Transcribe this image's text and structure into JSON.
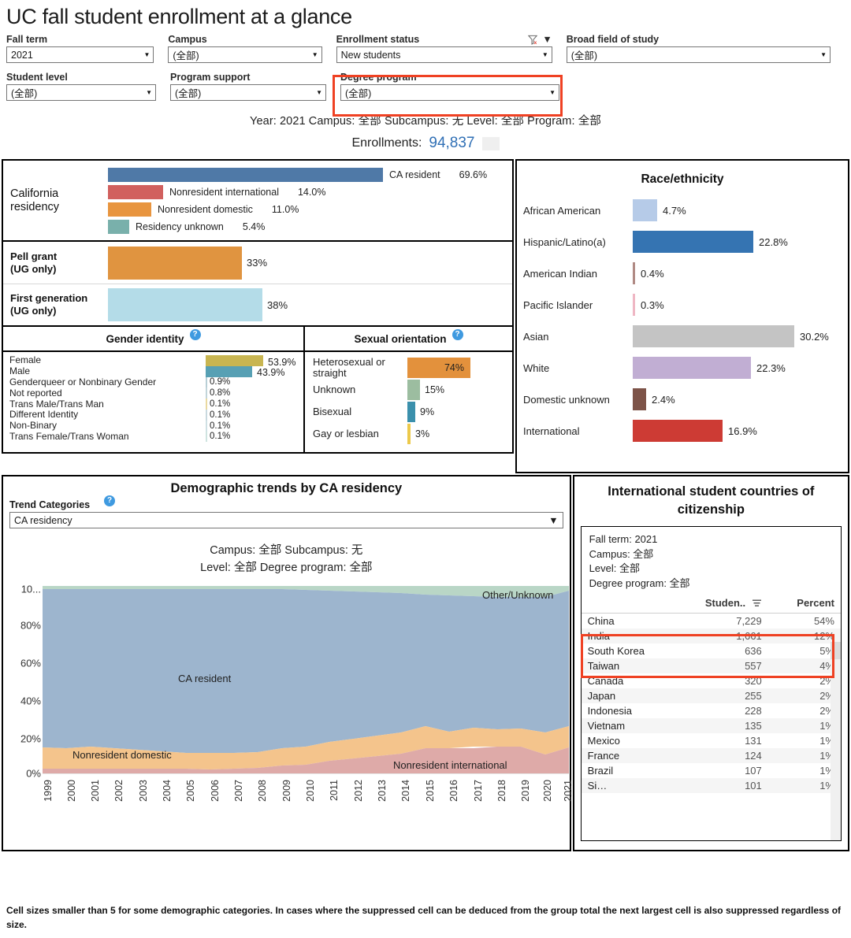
{
  "page": {
    "title": "UC fall student enrollment at a glance",
    "footnote": "Cell sizes smaller than 5 for some demographic categories. In cases where the suppressed cell can be deduced from the group total the next largest cell is also suppressed regardless of size.",
    "accent_highlight": "#ef4123"
  },
  "filters": {
    "row1": [
      {
        "label": "Fall term",
        "value": "2021"
      },
      {
        "label": "Campus",
        "value": "(全部)"
      },
      {
        "label": "Enrollment status",
        "value": "New students",
        "highlighted": true,
        "icons": [
          "clear-filter-icon",
          "chevron-down-icon"
        ]
      },
      {
        "label": "Broad field of study",
        "value": "(全部)"
      }
    ],
    "row2": [
      {
        "label": "Student level",
        "value": "(全部)"
      },
      {
        "label": "Program support",
        "value": "(全部)"
      },
      {
        "label": "Degree program",
        "value": "(全部)"
      }
    ]
  },
  "summary": {
    "context_line": "Year: 2021  Campus: 全部  Subcampus: 无  Level: 全部  Program: 全部",
    "enrollments_label": "Enrollments:",
    "enrollments_value": "94,837"
  },
  "chart_data": [
    {
      "type": "bar",
      "title": "California residency",
      "orientation": "horizontal",
      "categories": [
        "CA resident",
        "Nonresident international",
        "Nonresident domestic",
        "Residency unknown"
      ],
      "values": [
        69.6,
        14.0,
        11.0,
        5.4
      ],
      "value_labels": [
        "69.6%",
        "14.0%",
        "11.0%",
        "5.4%"
      ],
      "colors": [
        "#4f79a7",
        "#d1605e",
        "#e8953f",
        "#79b0ab"
      ],
      "xlabel": "",
      "ylabel": "",
      "xlim": [
        0,
        69.6
      ]
    },
    {
      "type": "bar",
      "title": "Pell grant (UG only) / First generation (UG only)",
      "orientation": "horizontal",
      "categories": [
        "Pell grant\n(UG only)",
        "First generation\n(UG only)"
      ],
      "values": [
        33,
        38
      ],
      "value_labels": [
        "33%",
        "38%"
      ],
      "colors": [
        "#e09440",
        "#b4dce8"
      ],
      "xlim": [
        0,
        100
      ]
    },
    {
      "type": "bar",
      "title": "Gender identity",
      "orientation": "horizontal",
      "categories": [
        "Female",
        "Male",
        "Genderqueer or Nonbinary Gender",
        "Not reported",
        "Trans Male/Trans Man",
        "Different Identity",
        "Non-Binary",
        "Trans Female/Trans Woman"
      ],
      "values": [
        53.9,
        43.9,
        0.9,
        0.8,
        0.1,
        0.1,
        0.1,
        0.1
      ],
      "value_labels": [
        "53.9%",
        "43.9%",
        "0.9%",
        "0.8%",
        "0.1%",
        "0.1%",
        "0.1%",
        "0.1%"
      ],
      "colors": [
        "#c8b551",
        "#57a0b4",
        "#b8cfd6",
        "#b8cfd6",
        "#ead9a0",
        "#c9d9df",
        "#cfe0e4",
        "#cfe4e0"
      ],
      "xlim": [
        0,
        53.9
      ]
    },
    {
      "type": "bar",
      "title": "Sexual orientation",
      "orientation": "horizontal",
      "categories": [
        "Heterosexual or straight",
        "Unknown",
        "Bisexual",
        "Gay or lesbian"
      ],
      "values": [
        74,
        15,
        9,
        3
      ],
      "value_labels": [
        "74%",
        "15%",
        "9%",
        "3%"
      ],
      "colors": [
        "#e3913c",
        "#9cbda0",
        "#3b90ac",
        "#ecc94b"
      ],
      "xlim": [
        0,
        74
      ]
    },
    {
      "type": "bar",
      "title": "Race/ethnicity",
      "orientation": "horizontal",
      "categories": [
        "African American",
        "Hispanic/Latino(a)",
        "American Indian",
        "Pacific Islander",
        "Asian",
        "White",
        "Domestic unknown",
        "International"
      ],
      "values": [
        4.7,
        22.8,
        0.4,
        0.3,
        30.2,
        22.3,
        2.4,
        16.9
      ],
      "value_labels": [
        "4.7%",
        "22.8%",
        "0.4%",
        "0.3%",
        "30.2%",
        "22.3%",
        "2.4%",
        "16.9%"
      ],
      "colors": [
        "#b6cbe8",
        "#3574b2",
        "#b08a84",
        "#efb7c4",
        "#c4c4c4",
        "#c1aed3",
        "#7d5348",
        "#cd3b34"
      ],
      "xlim": [
        0,
        30.2
      ]
    },
    {
      "type": "area",
      "title": "Demographic trends by CA residency",
      "stacked": true,
      "x": [
        1999,
        2000,
        2001,
        2002,
        2003,
        2004,
        2005,
        2006,
        2007,
        2008,
        2009,
        2010,
        2011,
        2012,
        2013,
        2014,
        2015,
        2016,
        2017,
        2018,
        2019,
        2020,
        2021
      ],
      "ylabel": "",
      "xlabel": "",
      "ylim": [
        0,
        100
      ],
      "ytick_labels": [
        "0%",
        "20%",
        "40%",
        "60%",
        "80%",
        "10..."
      ],
      "legend_position": "inline-annotations",
      "series": [
        {
          "name": "Nonresident international",
          "color": "#deaaa8",
          "values": [
            2.6,
            2.5,
            2.5,
            2.4,
            2.4,
            2.3,
            2.2,
            2.4,
            2.6,
            2.8,
            3.2,
            4.4,
            6.3,
            7.9,
            9.3,
            11.0,
            13.2,
            13.3,
            13.6,
            14.0,
            14.2,
            10.5,
            14.0
          ]
        },
        {
          "name": "Nonresident domestic",
          "color": "#f4c48c",
          "values": [
            11.3,
            11.4,
            11.9,
            11.3,
            11.1,
            10.7,
            10.4,
            9.6,
            9.8,
            9.7,
            9.9,
            9.6,
            10.9,
            11.3,
            11.1,
            10.8,
            11.5,
            9.5,
            10.3,
            10.1,
            9.4,
            9.4,
            11.0
          ]
        },
        {
          "name": "CA resident",
          "color": "#9db5ce",
          "values": [
            84.6,
            84.6,
            84.1,
            84.8,
            85.0,
            85.5,
            86.0,
            86.5,
            86.1,
            86.1,
            85.4,
            84.6,
            81.4,
            79.2,
            77.9,
            76.4,
            73.8,
            75.4,
            74.5,
            73.9,
            74.4,
            78.1,
            69.6
          ]
        },
        {
          "name": "Other/Unknown",
          "color": "#b9d6c6",
          "values": [
            1.5,
            1.5,
            1.5,
            1.5,
            1.5,
            1.5,
            1.4,
            1.5,
            1.5,
            1.4,
            1.5,
            1.4,
            1.4,
            1.6,
            1.7,
            1.8,
            1.5,
            1.8,
            1.6,
            2.0,
            2.0,
            2.0,
            5.4
          ]
        }
      ],
      "annotations": [
        "CA resident",
        "Nonresident domestic",
        "Nonresident international",
        "Other/Unknown"
      ]
    }
  ],
  "panels": {
    "california_residency": {
      "title": "California residency",
      "items": [
        {
          "label": "CA resident",
          "value": "69.6%",
          "pct": 69.6,
          "color": "#4f79a7"
        },
        {
          "label": "Nonresident international",
          "value": "14.0%",
          "pct": 14.0,
          "color": "#d1605e"
        },
        {
          "label": "Nonresident domestic",
          "value": "11.0%",
          "pct": 11.0,
          "color": "#e8953f"
        },
        {
          "label": "Residency unknown",
          "value": "5.4%",
          "pct": 5.4,
          "color": "#79b0ab"
        }
      ]
    },
    "pell_firstgen": {
      "rows": [
        {
          "label_line1": "Pell grant",
          "label_line2": "(UG only)",
          "value": "33%",
          "pct": 33,
          "color": "#e09440"
        },
        {
          "label_line1": "First generation",
          "label_line2": "(UG only)",
          "value": "38%",
          "pct": 38,
          "color": "#b4dce8"
        }
      ]
    },
    "gender_identity": {
      "title": "Gender identity",
      "help": "?",
      "items": [
        {
          "label": "Female",
          "value": "53.9%",
          "pct": 53.9,
          "color": "#c8b551"
        },
        {
          "label": "Male",
          "value": "43.9%",
          "pct": 43.9,
          "color": "#57a0b4"
        },
        {
          "label": "Genderqueer or Nonbinary Gender",
          "value": "0.9%",
          "pct": 0.9,
          "color": "#b8cfd6"
        },
        {
          "label": "Not reported",
          "value": "0.8%",
          "pct": 0.8,
          "color": "#c2d5da"
        },
        {
          "label": "Trans Male/Trans Man",
          "value": "0.1%",
          "pct": 0.1,
          "color": "#ead9a0"
        },
        {
          "label": "Different Identity",
          "value": "0.1%",
          "pct": 0.1,
          "color": "#c9d9df"
        },
        {
          "label": "Non-Binary",
          "value": "0.1%",
          "pct": 0.1,
          "color": "#cfe0e4"
        },
        {
          "label": "Trans Female/Trans Woman",
          "value": "0.1%",
          "pct": 0.1,
          "color": "#cfe4e0"
        }
      ]
    },
    "sexual_orientation": {
      "title": "Sexual orientation",
      "help": "?",
      "items": [
        {
          "label": "Heterosexual or straight",
          "value": "74%",
          "pct": 74,
          "color": "#e3913c"
        },
        {
          "label": "Unknown",
          "value": "15%",
          "pct": 15,
          "color": "#9cbda0"
        },
        {
          "label": "Bisexual",
          "value": "9%",
          "pct": 9,
          "color": "#3b90ac"
        },
        {
          "label": "Gay or lesbian",
          "value": "3%",
          "pct": 3,
          "color": "#ecc94b"
        }
      ]
    },
    "race_ethnicity": {
      "title": "Race/ethnicity",
      "items": [
        {
          "label": "African American",
          "value": "4.7%",
          "pct": 4.7,
          "color": "#b6cbe8"
        },
        {
          "label": "Hispanic/Latino(a)",
          "value": "22.8%",
          "pct": 22.8,
          "color": "#3574b2"
        },
        {
          "label": "American Indian",
          "value": "0.4%",
          "pct": 0.4,
          "color": "#b08a84"
        },
        {
          "label": "Pacific Islander",
          "value": "0.3%",
          "pct": 0.3,
          "color": "#efb7c4"
        },
        {
          "label": "Asian",
          "value": "30.2%",
          "pct": 30.2,
          "color": "#c4c4c4"
        },
        {
          "label": "White",
          "value": "22.3%",
          "pct": 22.3,
          "color": "#c1aed3"
        },
        {
          "label": "Domestic unknown",
          "value": "2.4%",
          "pct": 2.4,
          "color": "#7d5348"
        },
        {
          "label": "International",
          "value": "16.9%",
          "pct": 16.9,
          "color": "#cd3b34"
        }
      ]
    },
    "trend": {
      "title": "Demographic trends by CA residency",
      "categories_label": "Trend Categories",
      "help": "?",
      "selected_category": "CA residency",
      "subtitle_line1": "Campus: 全部    Subcampus: 无",
      "subtitle_line2": "Level: 全部    Degree program: 全部",
      "y_ticks": [
        "10...",
        "80%",
        "60%",
        "40%",
        "20%",
        "0%"
      ],
      "x_ticks": [
        "1999",
        "2000",
        "2001",
        "2002",
        "2003",
        "2004",
        "2005",
        "2006",
        "2007",
        "2008",
        "2009",
        "2010",
        "2011",
        "2012",
        "2013",
        "2014",
        "2015",
        "2016",
        "2017",
        "2018",
        "2019",
        "2020",
        "2021"
      ],
      "annotations": {
        "other_unknown": "Other/Unknown",
        "ca_resident": "CA resident",
        "nonresident_domestic": "Nonresident domestic",
        "nonresident_international": "Nonresident international"
      }
    },
    "international": {
      "title": "International student countries of citizenship",
      "meta": [
        "Fall term: 2021",
        "Campus: 全部",
        "Level: 全部",
        "Degree program: 全部"
      ],
      "columns": [
        "",
        "Studen..",
        "Percent"
      ],
      "rows": [
        {
          "country": "China",
          "students": "7,229",
          "percent": "54%",
          "highlighted": true
        },
        {
          "country": "India",
          "students": "1,661",
          "percent": "12%",
          "highlighted": true
        },
        {
          "country": "South Korea",
          "students": "636",
          "percent": "5%"
        },
        {
          "country": "Taiwan",
          "students": "557",
          "percent": "4%"
        },
        {
          "country": "Canada",
          "students": "320",
          "percent": "2%"
        },
        {
          "country": "Japan",
          "students": "255",
          "percent": "2%"
        },
        {
          "country": "Indonesia",
          "students": "228",
          "percent": "2%"
        },
        {
          "country": "Vietnam",
          "students": "135",
          "percent": "1%"
        },
        {
          "country": "Mexico",
          "students": "131",
          "percent": "1%"
        },
        {
          "country": "France",
          "students": "124",
          "percent": "1%"
        },
        {
          "country": "Brazil",
          "students": "107",
          "percent": "1%"
        },
        {
          "country": "Si…",
          "students": "101",
          "percent": "1%"
        }
      ]
    }
  }
}
